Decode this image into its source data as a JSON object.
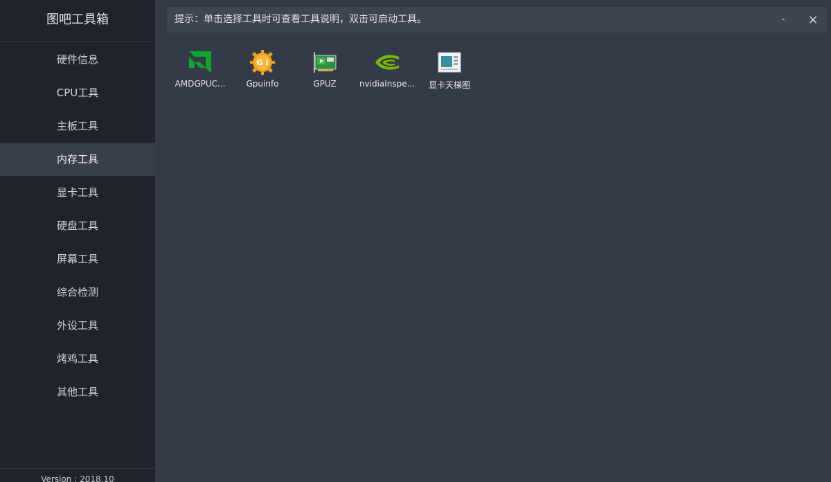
{
  "sidebar": {
    "title": "图吧工具箱",
    "items": [
      {
        "label": "硬件信息"
      },
      {
        "label": "CPU工具"
      },
      {
        "label": "主板工具"
      },
      {
        "label": "内存工具",
        "active": true
      },
      {
        "label": "显卡工具"
      },
      {
        "label": "硬盘工具"
      },
      {
        "label": "屏幕工具"
      },
      {
        "label": "综合检测"
      },
      {
        "label": "外设工具"
      },
      {
        "label": "烤鸡工具"
      },
      {
        "label": "其他工具"
      }
    ],
    "version": "Version : 2018.10"
  },
  "topbar": {
    "hint": "提示：单击选择工具时可查看工具说明，双击可启动工具。",
    "minimize_label": "-",
    "close_label": "×"
  },
  "tools": [
    {
      "label": "AMDGPUC...",
      "icon": "amd-icon"
    },
    {
      "label": "Gpuinfo",
      "icon": "gpuinfo-icon"
    },
    {
      "label": "GPUZ",
      "icon": "gpuz-icon"
    },
    {
      "label": "nvidiaInspe...",
      "icon": "nvidia-icon"
    },
    {
      "label": "显卡天梯图",
      "icon": "image-icon"
    }
  ],
  "colors": {
    "sidebar_bg": "#1f232c",
    "main_bg": "#343a47",
    "active_item_bg": "#383e4b",
    "amd_green": "#0ea52d",
    "nvidia_green": "#76b900",
    "gpuinfo_orange": "#f0a11a"
  }
}
